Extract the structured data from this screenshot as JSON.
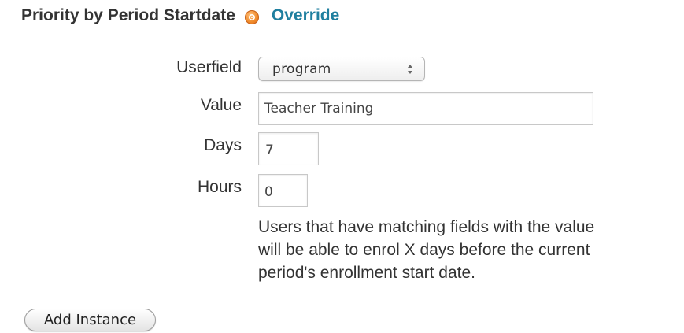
{
  "section": {
    "title": "Priority by Period Startdate",
    "help_icon": "help-icon",
    "override_label": "Override"
  },
  "form": {
    "userfield": {
      "label": "Userfield",
      "selected": "program"
    },
    "value": {
      "label": "Value",
      "current": "Teacher Training"
    },
    "days": {
      "label": "Days",
      "current": "7"
    },
    "hours": {
      "label": "Hours",
      "current": "0"
    },
    "help_lines": [
      "Users that have matching fields with the value",
      "will be able to enrol X days before the current",
      "period's enrollment start date."
    ]
  },
  "actions": {
    "add_instance_label": "Add Instance"
  },
  "colors": {
    "link": "#1f7f9f",
    "help_icon": "#f08a2a",
    "text": "#333333"
  }
}
